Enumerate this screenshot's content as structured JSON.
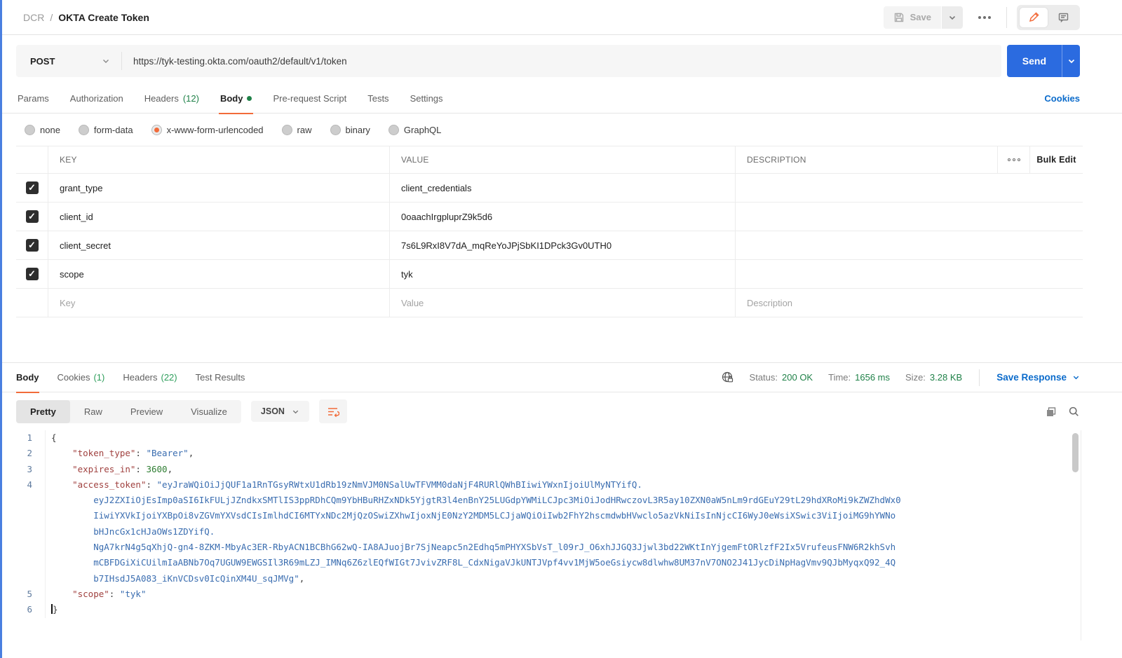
{
  "colors": {
    "accent_orange": "#f26b3a",
    "send_blue": "#2b6be0",
    "link_blue": "#0b6bcb",
    "status_green": "#1f8148"
  },
  "header": {
    "breadcrumb_folder": "DCR",
    "breadcrumb_sep": "/",
    "breadcrumb_name": "OKTA Create Token",
    "save_label": "Save"
  },
  "request": {
    "method": "POST",
    "url": "https://tyk-testing.okta.com/oauth2/default/v1/token",
    "send_label": "Send"
  },
  "request_tabs": {
    "params": "Params",
    "authorization": "Authorization",
    "headers": "Headers",
    "headers_count": "(12)",
    "body": "Body",
    "pre_request": "Pre-request Script",
    "tests": "Tests",
    "settings": "Settings",
    "cookies_link": "Cookies"
  },
  "body_modes": {
    "none": "none",
    "form_data": "form-data",
    "urlencoded": "x-www-form-urlencoded",
    "raw": "raw",
    "binary": "binary",
    "graphql": "GraphQL"
  },
  "params_table": {
    "headers": {
      "key": "KEY",
      "value": "VALUE",
      "description": "DESCRIPTION",
      "bulk_edit": "Bulk Edit"
    },
    "check_glyph": "✓",
    "rows": [
      {
        "key": "grant_type",
        "value": "client_credentials",
        "description": ""
      },
      {
        "key": "client_id",
        "value": "0oaachIrgpluprZ9k5d6",
        "description": ""
      },
      {
        "key": "client_secret",
        "value": "7s6L9RxI8V7dA_mqReYoJPjSbKI1DPck3Gv0UTH0",
        "description": ""
      },
      {
        "key": "scope",
        "value": "tyk",
        "description": ""
      }
    ],
    "placeholder_row": {
      "key": "Key",
      "value": "Value",
      "description": "Description"
    }
  },
  "response": {
    "tabs": {
      "body": "Body",
      "cookies": "Cookies",
      "cookies_count": "(1)",
      "headers": "Headers",
      "headers_count": "(22)",
      "test_results": "Test Results"
    },
    "status_label": "Status:",
    "status_value": "200 OK",
    "time_label": "Time:",
    "time_value": "1656 ms",
    "size_label": "Size:",
    "size_value": "3.28 KB",
    "save_response_label": "Save Response"
  },
  "viewer": {
    "pretty": "Pretty",
    "raw": "Raw",
    "preview": "Preview",
    "visualize": "Visualize",
    "format": "JSON"
  },
  "code": {
    "rows": [
      {
        "num": "1",
        "segments": [
          {
            "type": "pun",
            "text": "{"
          }
        ]
      },
      {
        "num": "2",
        "segments": [
          {
            "type": "pun",
            "text": "    "
          },
          {
            "type": "key",
            "text": "\"token_type\""
          },
          {
            "type": "pun",
            "text": ": "
          },
          {
            "type": "str",
            "text": "\"Bearer\""
          },
          {
            "type": "pun",
            "text": ","
          }
        ]
      },
      {
        "num": "3",
        "segments": [
          {
            "type": "pun",
            "text": "    "
          },
          {
            "type": "key",
            "text": "\"expires_in\""
          },
          {
            "type": "pun",
            "text": ": "
          },
          {
            "type": "num",
            "text": "3600"
          },
          {
            "type": "pun",
            "text": ","
          }
        ]
      },
      {
        "num": "4",
        "segments": [
          {
            "type": "pun",
            "text": "    "
          },
          {
            "type": "key",
            "text": "\"access_token\""
          },
          {
            "type": "pun",
            "text": ": "
          },
          {
            "type": "str",
            "text": "\"eyJraWQiOiJjQUF1a1RnTGsyRWtxU1dRb19zNmVJM0NSalUwTFVMM0daNjF4RURlQWhBIiwiYWxnIjoiUlMyNTYifQ."
          }
        ]
      },
      {
        "num": "",
        "segments": [
          {
            "type": "pun",
            "text": "        "
          },
          {
            "type": "str",
            "text": "eyJ2ZXIiOjEsImp0aSI6IkFULjJZndkxSMTlIS3ppRDhCQm9YbHBuRHZxNDk5YjgtR3l4enBnY25LUGdpYWMiLCJpc3MiOiJodHRwczovL3R5ay10ZXN0aW5nLm9rdGEuY29tL29hdXRoMi9kZWZhdWx0"
          }
        ]
      },
      {
        "num": "",
        "segments": [
          {
            "type": "pun",
            "text": "        "
          },
          {
            "type": "str",
            "text": "IiwiYXVkIjoiYXBpOi8vZGVmYXVsdCIsImlhdCI6MTYxNDc2MjQzOSwiZXhwIjoxNjE0NzY2MDM5LCJjaWQiOiIwb2FhY2hscmdwbHVwclo5azVkNiIsInNjcCI6WyJ0eWsiXSwic3ViIjoiMG9hYWNo"
          }
        ]
      },
      {
        "num": "",
        "segments": [
          {
            "type": "pun",
            "text": "        "
          },
          {
            "type": "str",
            "text": "bHJncGx1cHJaOWs1ZDYifQ."
          }
        ]
      },
      {
        "num": "",
        "segments": [
          {
            "type": "pun",
            "text": "        "
          },
          {
            "type": "str",
            "text": "NgA7krN4g5qXhjQ-gn4-8ZKM-MbyAc3ER-RbyACN1BCBhG62wQ-IA8AJuojBr7SjNeapc5n2Edhq5mPHYXSbVsT_l09rJ_O6xhJJGQ3Jjwl3bd22WKtInYjgemFtORlzfF2Ix5VrufeusFNW6R2khSvh"
          }
        ]
      },
      {
        "num": "",
        "segments": [
          {
            "type": "pun",
            "text": "        "
          },
          {
            "type": "str",
            "text": "mCBFDGiXiCUilmIaABNb7Oq7UGUW9EWGSIl3R69mLZJ_IMNq6Z6zlEQfWIGt7JvivZRF8L_CdxNigaVJkUNTJVpf4vv1MjW5oeGsiycw8dlwhw8UM37nV7ONO2J41JycDiNpHagVmv9QJbMyqxQ92_4Q"
          }
        ]
      },
      {
        "num": "",
        "segments": [
          {
            "type": "pun",
            "text": "        "
          },
          {
            "type": "str",
            "text": "b7IHsdJ5A083_iKnVCDsv0IcQinXM4U_sqJMVg\""
          },
          {
            "type": "pun",
            "text": ","
          }
        ]
      },
      {
        "num": "5",
        "segments": [
          {
            "type": "pun",
            "text": "    "
          },
          {
            "type": "key",
            "text": "\"scope\""
          },
          {
            "type": "pun",
            "text": ": "
          },
          {
            "type": "str",
            "text": "\"tyk\""
          }
        ]
      },
      {
        "num": "6",
        "segments": [
          {
            "type": "cursor",
            "text": ""
          },
          {
            "type": "pun",
            "text": "}"
          }
        ]
      }
    ]
  }
}
